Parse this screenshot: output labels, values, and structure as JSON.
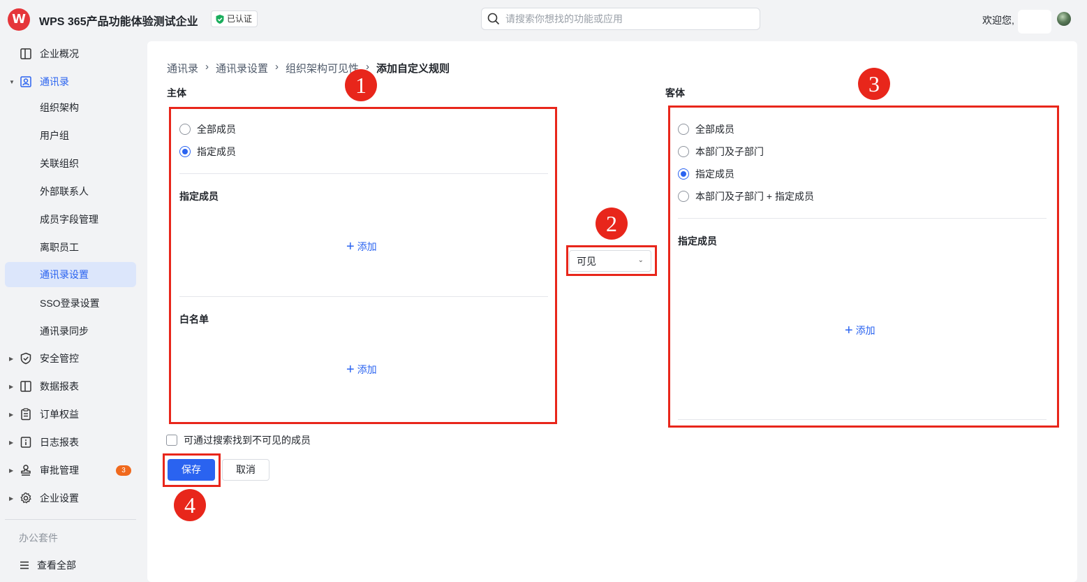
{
  "header": {
    "logo_text": "W",
    "org_name": "WPS 365产品功能体验测试企业",
    "verified_label": "已认证",
    "search_placeholder": "请搜索你想找的功能或应用",
    "welcome": "欢迎您,"
  },
  "sidebar": {
    "items": [
      {
        "label": "企业概况",
        "icon": "building-icon"
      },
      {
        "label": "通讯录",
        "icon": "contacts-icon",
        "expanded": true
      },
      {
        "label": "安全管控",
        "icon": "shield-check-icon"
      },
      {
        "label": "数据报表",
        "icon": "report-icon"
      },
      {
        "label": "订单权益",
        "icon": "clipboard-icon"
      },
      {
        "label": "日志报表",
        "icon": "log-icon"
      },
      {
        "label": "审批管理",
        "icon": "stamp-icon",
        "badge": "3"
      },
      {
        "label": "企业设置",
        "icon": "gear-icon"
      }
    ],
    "contacts_sub": [
      {
        "label": "组织架构"
      },
      {
        "label": "用户组"
      },
      {
        "label": "关联组织"
      },
      {
        "label": "外部联系人"
      },
      {
        "label": "成员字段管理"
      },
      {
        "label": "离职员工"
      },
      {
        "label": "通讯录设置",
        "selected": true
      },
      {
        "label": "SSO登录设置"
      },
      {
        "label": "通讯录同步"
      }
    ],
    "suite_label": "办公套件",
    "view_all": "查看全部"
  },
  "breadcrumb": [
    "通讯录",
    "通讯录设置",
    "组织架构可见性",
    "添加自定义规则"
  ],
  "subject": {
    "title": "主体",
    "options": [
      {
        "label": "全部成员",
        "checked": false
      },
      {
        "label": "指定成员",
        "checked": true
      }
    ],
    "specified_title": "指定成员",
    "add_label": "添加",
    "whitelist_title": "白名单",
    "whitelist_add_label": "添加"
  },
  "visibility_select": {
    "value": "可见"
  },
  "object": {
    "title": "客体",
    "options": [
      {
        "label": "全部成员",
        "checked": false
      },
      {
        "label": "本部门及子部门",
        "checked": false
      },
      {
        "label": "指定成员",
        "checked": true
      },
      {
        "label": "本部门及子部门 + 指定成员",
        "checked": false
      }
    ],
    "specified_title": "指定成员",
    "add_label": "添加"
  },
  "search_checkbox_label": "可通过搜索找到不可见的成员",
  "actions": {
    "save": "保存",
    "cancel": "取消"
  },
  "markers": [
    "1",
    "2",
    "3",
    "4"
  ],
  "colors": {
    "accent": "#2a63f0",
    "highlight": "#e8261b",
    "badge": "#f0691d",
    "brand": "#e5363b"
  }
}
